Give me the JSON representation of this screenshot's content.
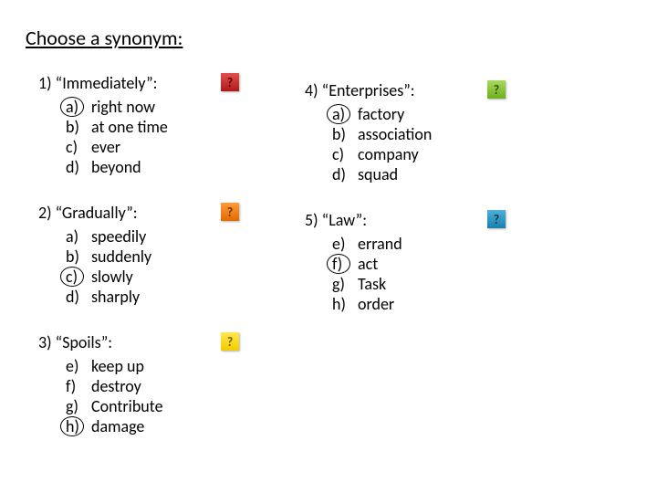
{
  "title": "Choose a synonym:",
  "columns": {
    "left": [
      {
        "number": "1)",
        "word": "“Immediately”:",
        "hint_color": "red",
        "options": [
          {
            "letter": "a)",
            "text": "right now",
            "circled": true
          },
          {
            "letter": "b)",
            "text": "at one time",
            "circled": false
          },
          {
            "letter": "c)",
            "text": "ever",
            "circled": false
          },
          {
            "letter": "d)",
            "text": "beyond",
            "circled": false
          }
        ]
      },
      {
        "number": "2)",
        "word": "“Gradually”:",
        "hint_color": "orange",
        "options": [
          {
            "letter": "a)",
            "text": "speedily",
            "circled": false
          },
          {
            "letter": "b)",
            "text": "suddenly",
            "circled": false
          },
          {
            "letter": "c)",
            "text": "slowly",
            "circled": true
          },
          {
            "letter": "d)",
            "text": "sharply",
            "circled": false
          }
        ]
      },
      {
        "number": "3)",
        "word": "“Spoils”:",
        "hint_color": "yellow",
        "options": [
          {
            "letter": "e)",
            "text": "keep up",
            "circled": false
          },
          {
            "letter": "f)",
            "text": "destroy",
            "circled": false
          },
          {
            "letter": "g)",
            "text": "Contribute",
            "circled": false
          },
          {
            "letter": "h)",
            "text": "damage",
            "circled": true
          }
        ]
      }
    ],
    "right": [
      {
        "number": "4)",
        "word": "“Enterprises”:",
        "hint_color": "green",
        "options": [
          {
            "letter": "a)",
            "text": "factory",
            "circled": true
          },
          {
            "letter": "b)",
            "text": "association",
            "circled": false
          },
          {
            "letter": "c)",
            "text": "company",
            "circled": false
          },
          {
            "letter": "d)",
            "text": "squad",
            "circled": false
          }
        ]
      },
      {
        "number": "5)",
        "word": "“Law”:",
        "hint_color": "blue",
        "options": [
          {
            "letter": "e)",
            "text": "errand",
            "circled": false
          },
          {
            "letter": "f)",
            "text": "act",
            "circled": true
          },
          {
            "letter": "g)",
            "text": "Task",
            "circled": false
          },
          {
            "letter": "h)",
            "text": "order",
            "circled": false
          }
        ]
      }
    ]
  }
}
